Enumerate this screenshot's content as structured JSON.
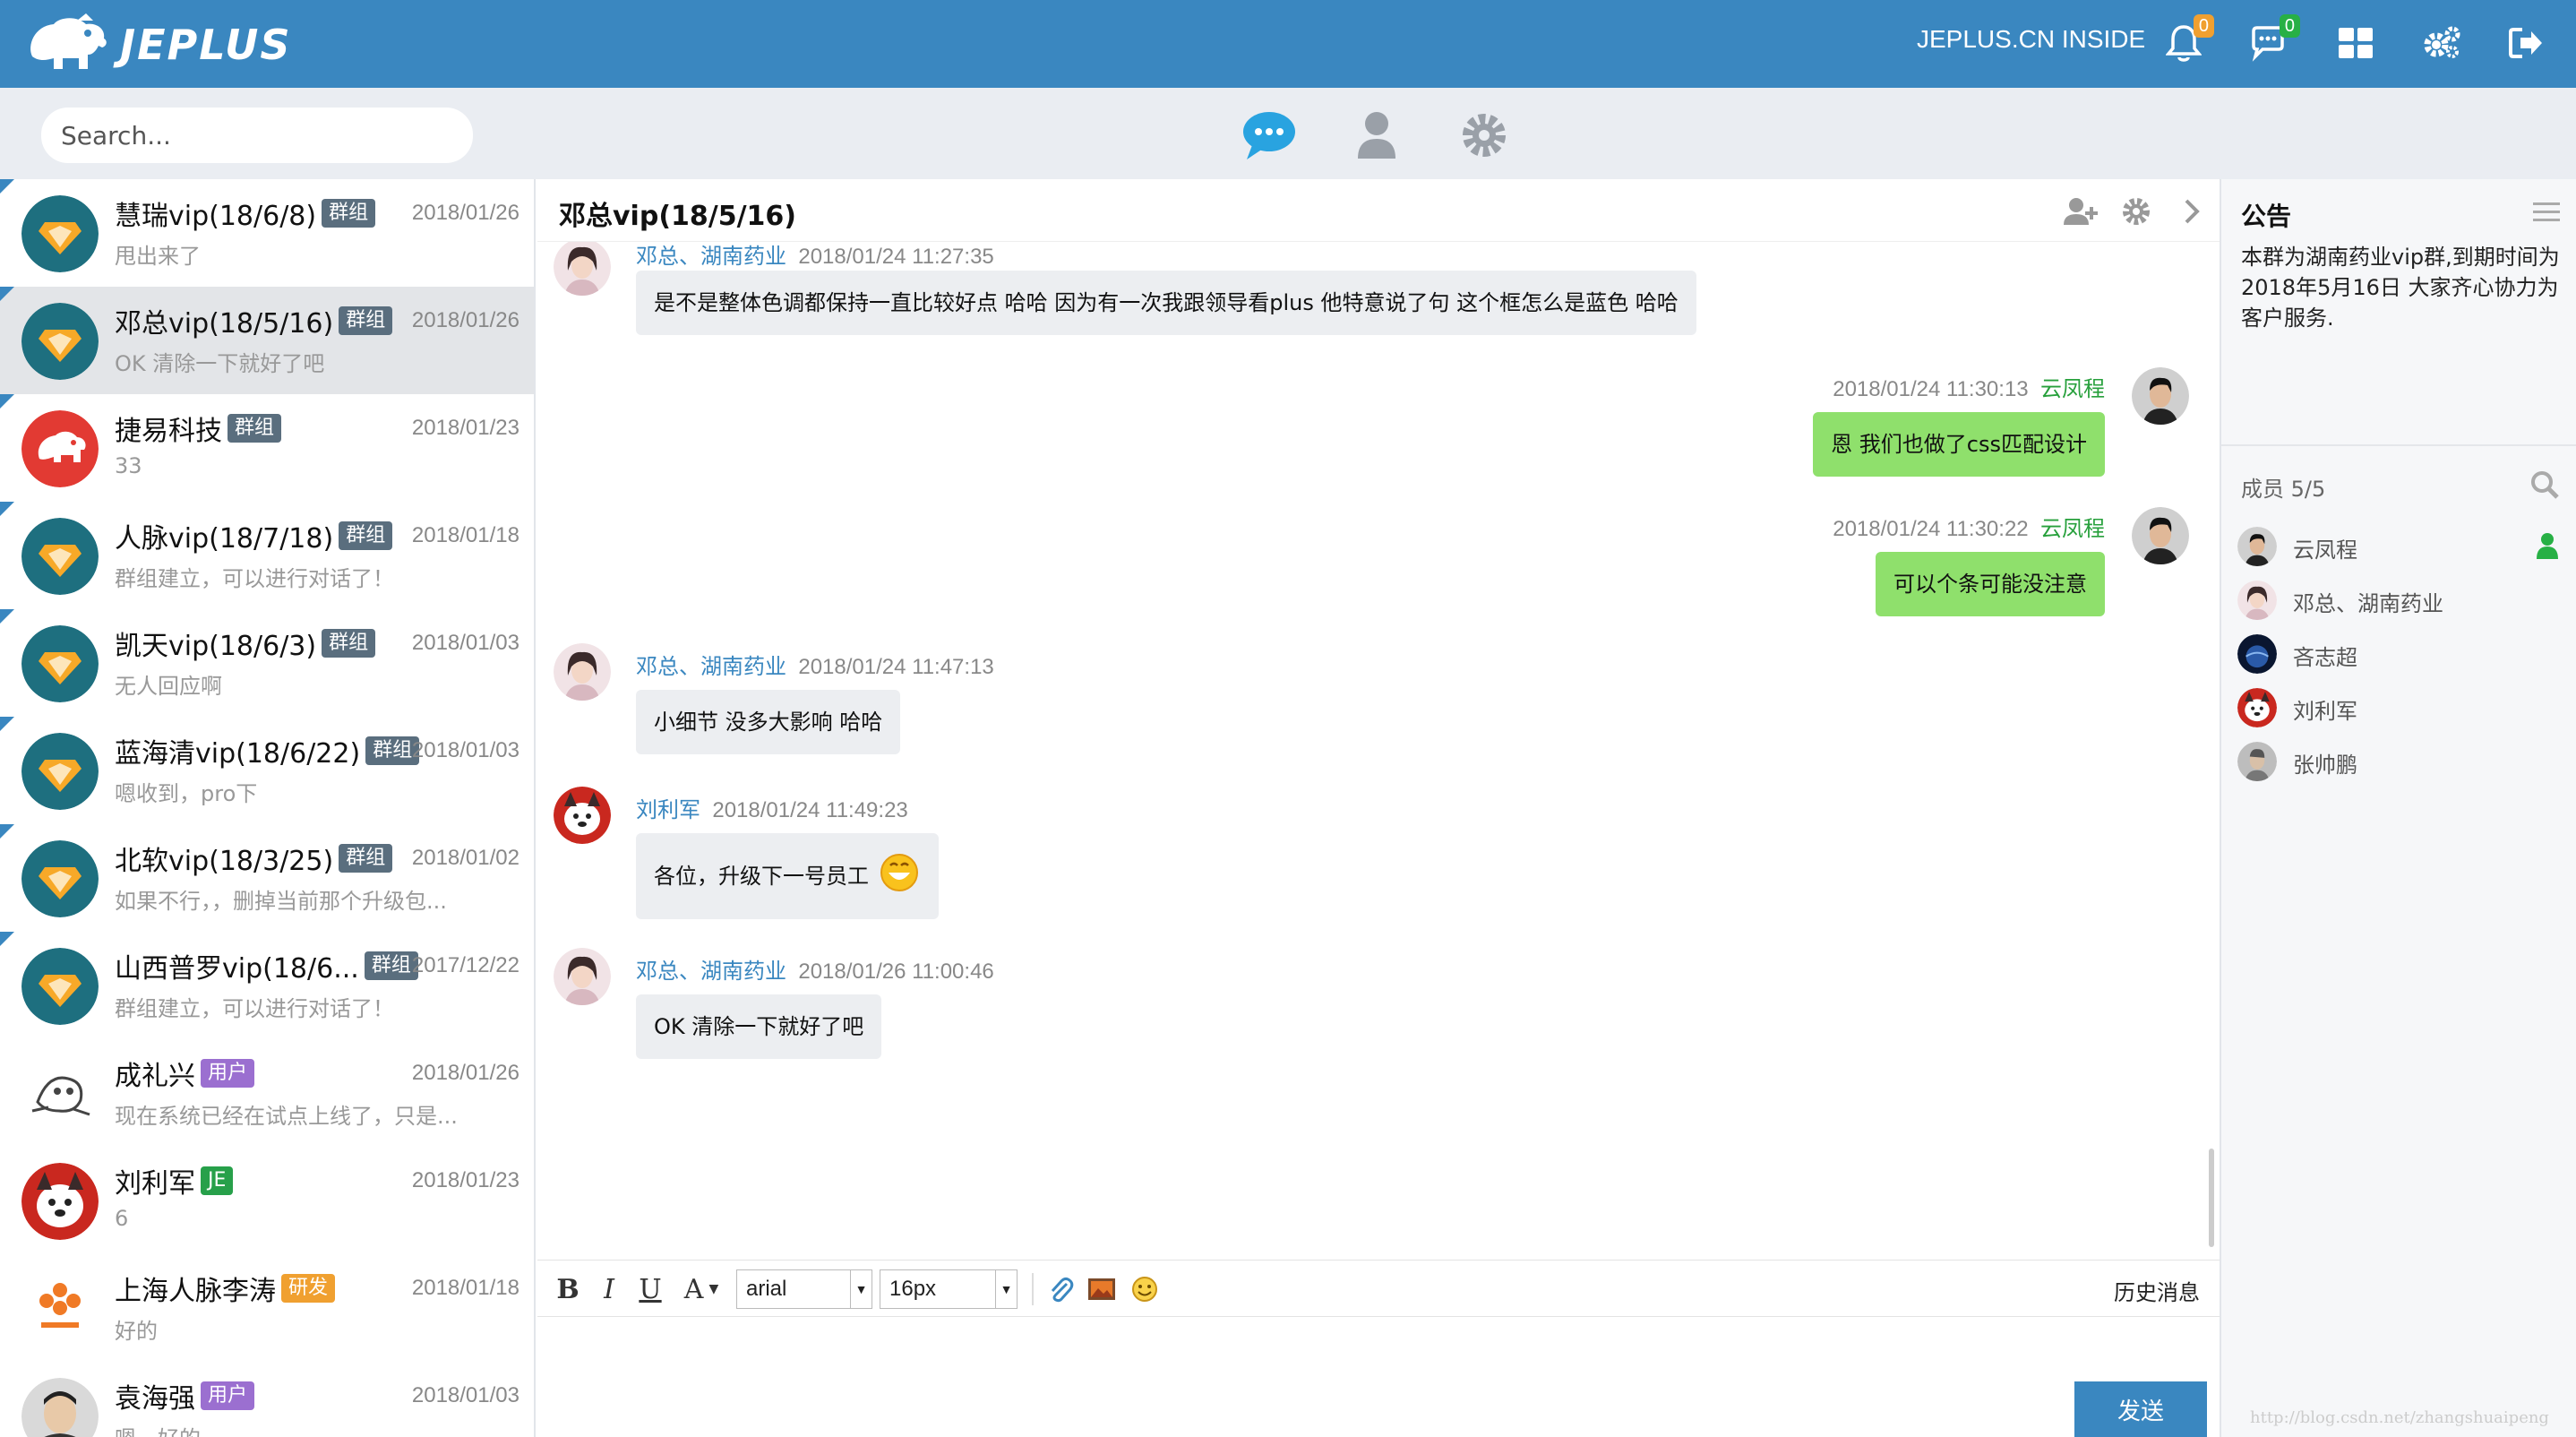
{
  "topbar": {
    "logo_text": "JEPLUS",
    "inside_label": "JEPLUS.CN INSIDE",
    "notification_count": "0",
    "message_count": "0",
    "colors": {
      "bar": "#3a87c0",
      "badge_orange": "#f0a030",
      "badge_green": "#27b045"
    }
  },
  "subbar": {
    "search_placeholder": "Search..."
  },
  "conversations": [
    {
      "name": "慧瑞vip(18/6/8)",
      "badge": "群组",
      "badge_color": "#5a6e7e",
      "date": "2018/01/26",
      "preview": "甩出来了",
      "avatar": "vip-diamond",
      "active": false
    },
    {
      "name": "邓总vip(18/5/16)",
      "badge": "群组",
      "badge_color": "#5a6e7e",
      "date": "2018/01/26",
      "preview": "OK 清除一下就好了吧",
      "avatar": "vip-diamond",
      "active": true
    },
    {
      "name": "捷易科技",
      "badge": "群组",
      "badge_color": "#5a6e7e",
      "date": "2018/01/23",
      "preview": "33",
      "avatar": "elephant-red",
      "active": false
    },
    {
      "name": "人脉vip(18/7/18)",
      "badge": "群组",
      "badge_color": "#5a6e7e",
      "date": "2018/01/18",
      "preview": "群组建立，可以进行对话了！",
      "avatar": "vip-diamond",
      "active": false
    },
    {
      "name": "凯天vip(18/6/3)",
      "badge": "群组",
      "badge_color": "#5a6e7e",
      "date": "2018/01/03",
      "preview": "无人回应啊",
      "avatar": "vip-diamond",
      "active": false
    },
    {
      "name": "蓝海清vip(18/6/22)",
      "badge": "群组",
      "badge_color": "#5a6e7e",
      "date": "2018/01/03",
      "preview": "嗯收到，pro下",
      "avatar": "vip-diamond",
      "active": false
    },
    {
      "name": "北软vip(18/3/25)",
      "badge": "群组",
      "badge_color": "#5a6e7e",
      "date": "2018/01/02",
      "preview": "如果不行，，删掉当前那个升级包...",
      "avatar": "vip-diamond",
      "active": false
    },
    {
      "name": "山西普罗vip(18/6...",
      "badge": "群组",
      "badge_color": "#5a6e7e",
      "date": "2017/12/22",
      "preview": "群组建立，可以进行对话了！",
      "avatar": "vip-diamond",
      "active": false
    },
    {
      "name": "成礼兴",
      "badge": "用户",
      "badge_color": "#9b6fd0",
      "date": "2018/01/26",
      "preview": "现在系统已经在试点上线了，只是...",
      "avatar": "sketch",
      "active": false
    },
    {
      "name": "刘利军",
      "badge": "JE",
      "badge_color": "#27a04a",
      "date": "2018/01/23",
      "preview": "6",
      "avatar": "dog",
      "active": false
    },
    {
      "name": "上海人脉李涛",
      "badge": "研发",
      "badge_color": "#f0a030",
      "date": "2018/01/18",
      "preview": "好的",
      "avatar": "renmai",
      "active": false
    },
    {
      "name": "袁海强",
      "badge": "用户",
      "badge_color": "#9b6fd0",
      "date": "2018/01/03",
      "preview": "嗯，好的",
      "avatar": "man",
      "active": false
    }
  ],
  "chat": {
    "title": "邓总vip(18/5/16)",
    "messages": [
      {
        "sender": "邓总、湖南药业",
        "time": "2018/01/24 11:27:35",
        "text": "是不是整体色调都保持一直比较好点 哈哈 因为有一次我跟领导看plus 他特意说了句 这个框怎么是蓝色 哈哈",
        "dir": "in"
      },
      {
        "sender": "云凤程",
        "time": "2018/01/24 11:30:13",
        "text": "恩 我们也做了css匹配设计",
        "dir": "out"
      },
      {
        "sender": "云凤程",
        "time": "2018/01/24 11:30:22",
        "text": "可以个条可能没注意",
        "dir": "out"
      },
      {
        "sender": "邓总、湖南药业",
        "time": "2018/01/24 11:47:13",
        "text": "小细节 没多大影响 哈哈",
        "dir": "in"
      },
      {
        "sender": "刘利军",
        "time": "2018/01/24 11:49:23",
        "text": "各位，升级下一号员工",
        "dir": "in"
      },
      {
        "sender": "邓总、湖南药业",
        "time": "2018/01/26 11:00:46",
        "text": "OK 清除一下就好了吧",
        "dir": "in"
      }
    ],
    "toolbar": {
      "bold": "B",
      "italic": "I",
      "underline": "U",
      "font_color": "A",
      "font_family": "arial",
      "font_size": "16px",
      "history_label": "历史消息"
    },
    "send_label": "发送",
    "colors": {
      "bubble_in": "#eceef1",
      "bubble_out": "#8fe06c",
      "sender": "#3a87c0",
      "me": "#27a03c"
    }
  },
  "right": {
    "notice_title": "公告",
    "notice_text": "本群为湖南药业vip群,到期时间为2018年5月16日 大家齐心协力为客户服务.",
    "members_title": "成员 5/5",
    "members": [
      {
        "name": "云凤程",
        "online": true
      },
      {
        "name": "邓总、湖南药业",
        "online": false
      },
      {
        "name": "吝志超",
        "online": false
      },
      {
        "name": "刘利军",
        "online": false
      },
      {
        "name": "张帅鹏",
        "online": false
      }
    ]
  },
  "watermark": "http://blog.csdn.net/zhangshuaipeng"
}
